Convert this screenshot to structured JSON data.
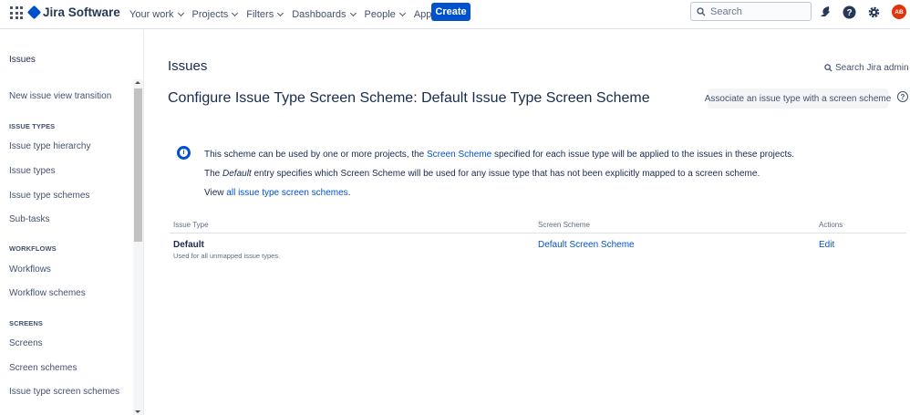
{
  "topnav": {
    "product_name": "Jira Software",
    "menus": [
      {
        "label": "Your work"
      },
      {
        "label": "Projects"
      },
      {
        "label": "Filters"
      },
      {
        "label": "Dashboards"
      },
      {
        "label": "People"
      },
      {
        "label": "Apps"
      }
    ],
    "create_label": "Create",
    "search_placeholder": "Search",
    "avatar_initials": "AB",
    "icons": [
      "app-switcher-icon",
      "notification-icon",
      "help-icon",
      "settings-icon"
    ]
  },
  "sidebar": {
    "title": "Issues",
    "items": [
      {
        "type": "link",
        "label": "New issue view transition"
      },
      {
        "type": "heading",
        "label": "ISSUE TYPES"
      },
      {
        "type": "link",
        "label": "Issue type hierarchy"
      },
      {
        "type": "link",
        "label": "Issue types"
      },
      {
        "type": "link",
        "label": "Issue type schemes"
      },
      {
        "type": "link",
        "label": "Sub-tasks"
      },
      {
        "type": "heading",
        "label": "WORKFLOWS"
      },
      {
        "type": "link",
        "label": "Workflows"
      },
      {
        "type": "link",
        "label": "Workflow schemes"
      },
      {
        "type": "heading",
        "label": "SCREENS"
      },
      {
        "type": "link",
        "label": "Screens"
      },
      {
        "type": "link",
        "label": "Screen schemes"
      },
      {
        "type": "link",
        "label": "Issue type screen schemes"
      }
    ]
  },
  "main": {
    "page_title": "Issues",
    "admin_search_label": "Search Jira admin",
    "heading": "Configure Issue Type Screen Scheme: Default Issue Type Screen Scheme",
    "associate_button": "Associate an issue type with a screen scheme",
    "info": {
      "line1_pre": "This scheme can be used by one or more projects, the ",
      "line1_link": "Screen Scheme",
      "line1_post": " specified for each issue type will be applied to the issues in these projects.",
      "line2_pre": "The ",
      "line2_em": "Default",
      "line2_post": " entry specifies which Screen Scheme will be used for any issue type that has not been explicitly mapped to a screen scheme.",
      "line3_pre": "View ",
      "line3_link": "all issue type screen schemes",
      "line3_post": "."
    },
    "table": {
      "headers": [
        "Issue Type",
        "Screen Scheme",
        "Actions"
      ],
      "rows": [
        {
          "issue_type": "Default",
          "description": "Used for all unmapped issue types.",
          "screen_scheme": "Default Screen Scheme",
          "action": "Edit"
        }
      ]
    }
  },
  "colors": {
    "brand": "#0052cc",
    "avatar": "#de350b",
    "text": "#172b4d",
    "subtle_text": "#42526e"
  }
}
